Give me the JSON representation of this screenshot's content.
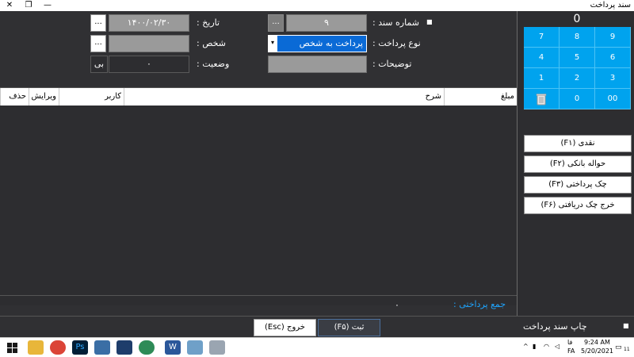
{
  "window": {
    "title": "سند پرداخت",
    "minimize": "—",
    "restore": "❐",
    "close": "✕"
  },
  "form": {
    "doc_no_label": "شماره سند :",
    "doc_no_value": "۹",
    "doc_no_button": "...",
    "date_label": "تاریخ :",
    "date_value": "۱۴۰۰/۰۲/۳۰",
    "date_button": "...",
    "pay_type_label": "نوع پرداخت :",
    "pay_type_value": "پرداخت به شخص",
    "person_label": "شخص :",
    "person_value": "",
    "person_button": "...",
    "desc_label": "توضیحات :",
    "desc_value": "",
    "status_label": "وضعیت :",
    "status_value": "۰",
    "status_button": "بی"
  },
  "grid": {
    "columns": [
      "مبلغ",
      "شرح",
      "کاربر",
      "ویرایش",
      "حذف"
    ]
  },
  "total": {
    "label": "جمع پرداختی :",
    "value": "۰"
  },
  "keypad": {
    "display": "0",
    "keys": [
      "7",
      "8",
      "9",
      "4",
      "5",
      "6",
      "1",
      "2",
      "3",
      "",
      "0",
      "00"
    ],
    "trash_icon": "trash-icon"
  },
  "payment_buttons": [
    "نقدی (F۱)",
    "حواله بانکی (F۲)",
    "چک پرداختی (F۳)",
    "خرج چک دریافتی (F۶)"
  ],
  "bottom": {
    "print_label": "چاپ سند پرداخت",
    "save_label": "ثبت (F۵)",
    "exit_label": "خروج (Esc)"
  },
  "taskbar": {
    "time": "9:24 AM",
    "date": "5/20/2021",
    "lang_top": "فا",
    "lang_bottom": "FA",
    "notification": "11"
  }
}
